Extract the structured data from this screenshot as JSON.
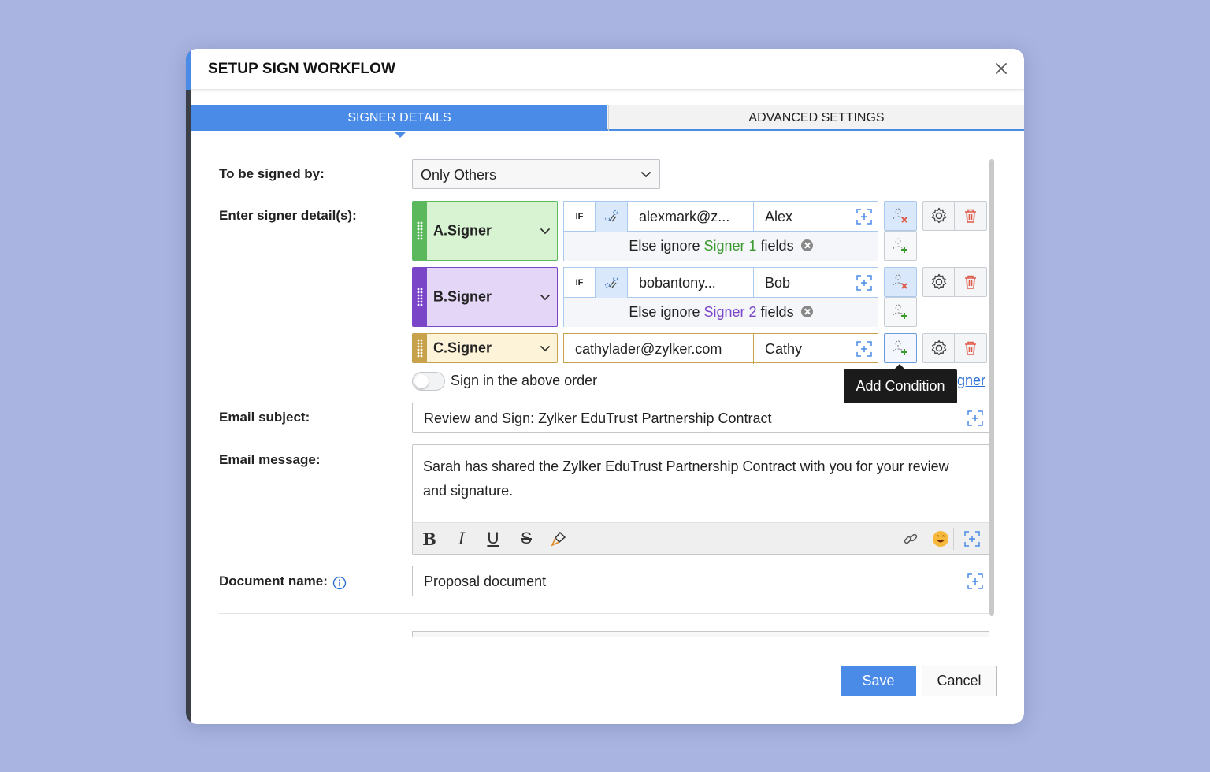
{
  "dialog": {
    "title": "SETUP SIGN WORKFLOW",
    "tabs": [
      {
        "label": "SIGNER DETAILS",
        "active": true
      },
      {
        "label": "ADVANCED SETTINGS",
        "active": false
      }
    ]
  },
  "form": {
    "signed_by_label": "To be signed by:",
    "signed_by_value": "Only Others",
    "signer_details_label": "Enter signer detail(s):",
    "signers": [
      {
        "role": "A.Signer",
        "color": "#5cb85c",
        "bg": "#d8f3d2",
        "condition": "IF",
        "email": "alexmark@z...",
        "name": "Alex",
        "else_prefix": "Else ignore",
        "else_signer": "Signer 1",
        "else_suffix": "fields",
        "else_color": "#3a9a2e"
      },
      {
        "role": "B.Signer",
        "color": "#7b45c8",
        "bg": "#e4d6f7",
        "condition": "IF",
        "email": "bobantony...",
        "name": "Bob",
        "else_prefix": "Else ignore",
        "else_signer": "Signer 2",
        "else_suffix": "fields",
        "else_color": "#7b45c8"
      },
      {
        "role": "C.Signer",
        "color": "#c8a24a",
        "bg": "#fdf3d8",
        "email": "cathylader@zylker.com",
        "name": "Cathy"
      }
    ],
    "sign_order_label": "Sign in the above order",
    "add_signer_link": "igner",
    "tooltip": "Add Condition",
    "email_subject_label": "Email subject:",
    "email_subject_value": "Review and Sign: Zylker EduTrust Partnership Contract",
    "email_message_label": "Email message:",
    "email_message_value": "Sarah has shared the Zylker EduTrust Partnership Contract with you for your review and signature.",
    "toolbar": {
      "bold": "B",
      "italic": "I",
      "underline": "U",
      "strike": "S"
    },
    "document_name_label": "Document name:",
    "document_name_value": "Proposal document"
  },
  "buttons": {
    "save": "Save",
    "cancel": "Cancel"
  },
  "colors": {
    "accent": "#4a8be8",
    "danger": "#e05a4a"
  }
}
